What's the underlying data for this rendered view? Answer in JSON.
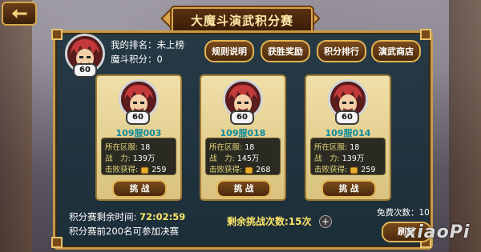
{
  "title": "大魔斗演武积分赛",
  "player": {
    "level": "60",
    "rank_label": "我的排名：",
    "rank_value": "未上榜",
    "points_label": "魔斗积分：",
    "points_value": "0"
  },
  "menu": [
    {
      "label": "规则说明"
    },
    {
      "label": "获胜奖励"
    },
    {
      "label": "积分排行"
    },
    {
      "label": "演武商店"
    }
  ],
  "opponents": [
    {
      "level": "60",
      "server_name": "109服003",
      "server_label": "所在区服:",
      "server": "18",
      "power_label": "战　力:",
      "power": "139万",
      "reward_label": "击败获得:",
      "reward": "259",
      "button": "挑 战"
    },
    {
      "level": "60",
      "server_name": "109服018",
      "server_label": "所在区服:",
      "server": "18",
      "power_label": "战　力:",
      "power": "145万",
      "reward_label": "击败获得:",
      "reward": "268",
      "button": "挑 战"
    },
    {
      "level": "60",
      "server_name": "109服014",
      "server_label": "所在区服:",
      "server": "18",
      "power_label": "战　力:",
      "power": "139万",
      "reward_label": "击败获得:",
      "reward": "259",
      "button": "挑 战"
    }
  ],
  "footer": {
    "timer_label": "积分赛剩余时间:",
    "timer_value": "72:02:59",
    "notice": "积分赛前200名可参加决赛",
    "remaining": "剩余挑战次数:15次",
    "plus": "+",
    "free_count": "免费次数：10",
    "refresh": "刷新"
  },
  "watermark": "xiaoPi",
  "colors": {
    "accent": "#e2b453",
    "teal": "#0a8a9a",
    "timer": "#ffe66a"
  },
  "icons": {
    "back": "back-arrow-icon",
    "coin": "coin-icon",
    "plus": "plus-icon"
  }
}
